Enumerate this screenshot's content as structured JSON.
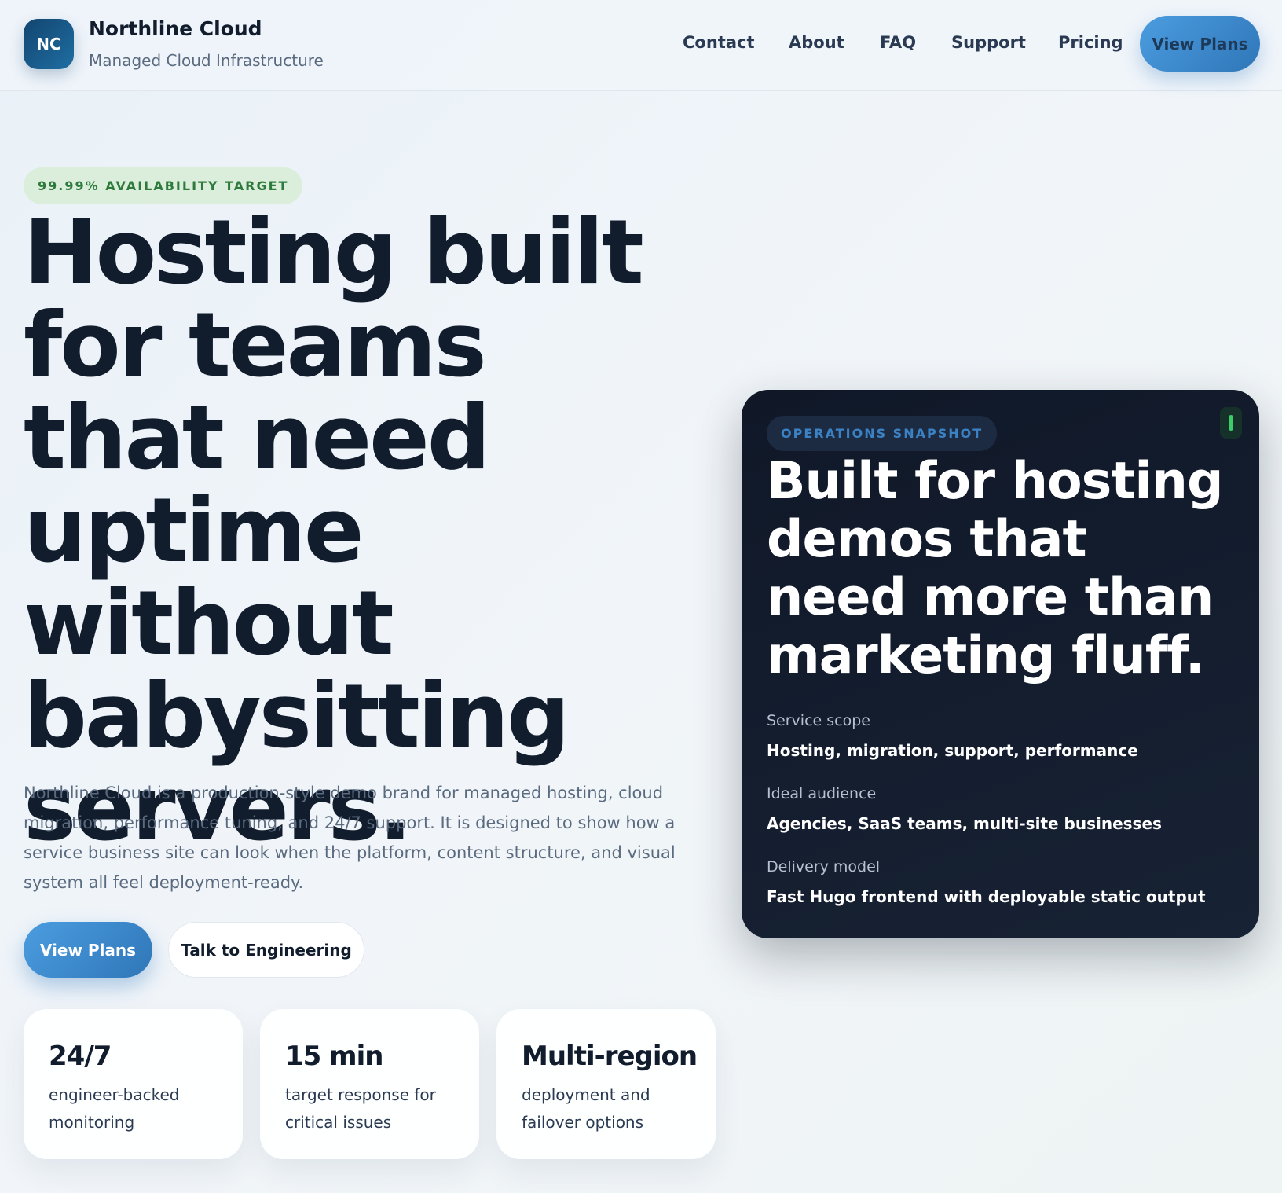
{
  "header": {
    "logo_initials": "NC",
    "brand_name": "Northline Cloud",
    "brand_tagline": "Managed Cloud Infrastructure",
    "nav": [
      {
        "label": "Contact"
      },
      {
        "label": "About"
      },
      {
        "label": "FAQ"
      },
      {
        "label": "Support"
      },
      {
        "label": "Pricing"
      }
    ],
    "cta_label": "View Plans"
  },
  "hero": {
    "eyebrow": "99.99% AVAILABILITY TARGET",
    "title": "Hosting built for teams that need uptime without babysitting servers.",
    "description": "Northline Cloud is a production-style demo brand for managed hosting, cloud migration, performance tuning, and 24/7 support. It is designed to show how a service business site can look when the platform, content structure, and visual system all feel deployment-ready.",
    "primary_button": "View Plans",
    "secondary_button": "Talk to Engineering",
    "stats": [
      {
        "value": "24/7",
        "label": "engineer-backed monitoring"
      },
      {
        "value": "15 min",
        "label": "target response for critical issues"
      },
      {
        "value": "Multi-region",
        "label": "deployment and failover options"
      }
    ]
  },
  "snapshot": {
    "pill": "OPERATIONS SNAPSHOT",
    "title": "Built for hosting demos that need more than marketing fluff.",
    "items": [
      {
        "label": "Service scope",
        "value": "Hosting, migration, support, performance"
      },
      {
        "label": "Ideal audience",
        "value": "Agencies, SaaS teams, multi-site businesses"
      },
      {
        "label": "Delivery model",
        "value": "Fast Hugo frontend with deployable static output"
      }
    ]
  },
  "colors": {
    "accent": "#3b8ad4",
    "dark_card": "#121b2b",
    "eyebrow_bg": "#dbeedc",
    "eyebrow_text": "#2e7a3c",
    "status_green": "#3ccc6a"
  }
}
